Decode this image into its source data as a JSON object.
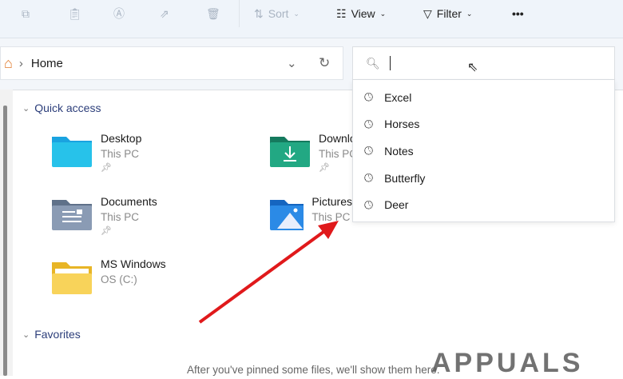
{
  "toolbar": {
    "sort": "Sort",
    "view": "View",
    "filter": "Filter",
    "more": "•••"
  },
  "address": {
    "location": "Home"
  },
  "search": {
    "value": "",
    "suggestions": [
      "Excel",
      "Horses",
      "Notes",
      "Butterfly",
      "Deer"
    ]
  },
  "quick_access": {
    "title": "Quick access",
    "items": [
      {
        "name": "Desktop",
        "location": "This PC",
        "color": "#1aa3e0"
      },
      {
        "name": "Downloads",
        "location": "This PC",
        "color": "#1f9a77"
      },
      {
        "name": "Documents",
        "location": "This PC",
        "color": "#7b8fa8"
      },
      {
        "name": "Pictures",
        "location": "This PC",
        "color": "#1e7fd6"
      },
      {
        "name": "MS Windows",
        "location": "OS (C:)",
        "color": "#f6c945"
      }
    ]
  },
  "favorites": {
    "title": "Favorites",
    "empty_text": "After you've pinned some files, we'll show them here."
  },
  "watermark": "APPUALS",
  "annotation_color": "#e0191b"
}
